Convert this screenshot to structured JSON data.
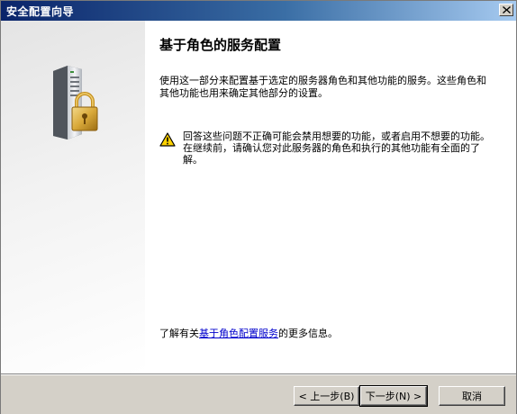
{
  "window": {
    "title": "安全配置向导",
    "close_symbol": "✕"
  },
  "page": {
    "title": "基于角色的服务配置",
    "description": "使用这一部分来配置基于选定的服务器角色和其他功能的服务。这些角色和其他功能也用来确定其他部分的设置。",
    "warning": "回答这些问题不正确可能会禁用想要的功能，或者启用不想要的功能。在继续前，请确认您对此服务器的角色和执行的其他功能有全面的了解。",
    "more_info_prefix": "了解有关",
    "more_info_link": "基于角色配置服务",
    "more_info_suffix": "的更多信息。"
  },
  "buttons": {
    "back": "< 上一步(B)",
    "next": "下一步(N) >",
    "cancel": "取消"
  },
  "icons": {
    "hero": "server-lock-icon",
    "warning": "warning-icon",
    "close": "close-icon"
  },
  "colors": {
    "titlebar_start": "#0a246a",
    "titlebar_end": "#a6caf0",
    "link": "#0000cc",
    "warning_yellow": "#ffd200"
  }
}
